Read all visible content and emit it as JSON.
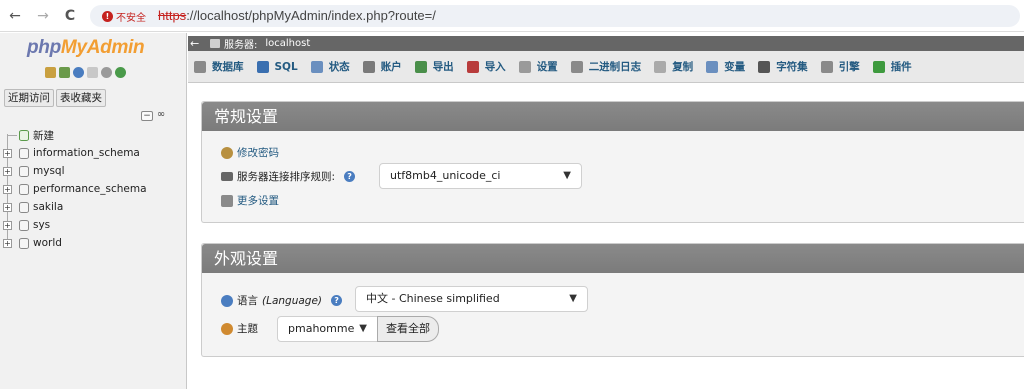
{
  "browser": {
    "back_icon": "←",
    "forward_icon": "→",
    "reload_icon": "C",
    "security_label": "不安全",
    "url_protocol": "https",
    "url_rest": "://localhost/phpMyAdmin/index.php?route=/"
  },
  "nav": {
    "logo_part1": "php",
    "logo_part2": "MyAdmin",
    "tabs": [
      "近期访问",
      "表收藏夹"
    ],
    "new_label": "新建",
    "databases": [
      "information_schema",
      "mysql",
      "performance_schema",
      "sakila",
      "sys",
      "world"
    ]
  },
  "server_bar": {
    "label": "服务器:",
    "server": "localhost"
  },
  "menu": [
    {
      "label": "数据库",
      "icon": "database-icon",
      "color": "#8a8a8a"
    },
    {
      "label": "SQL",
      "icon": "sql-icon",
      "color": "#3a6fb0"
    },
    {
      "label": "状态",
      "icon": "status-icon",
      "color": "#6a8fbf"
    },
    {
      "label": "账户",
      "icon": "accounts-icon",
      "color": "#7a7a7a"
    },
    {
      "label": "导出",
      "icon": "export-icon",
      "color": "#4a8f4a"
    },
    {
      "label": "导入",
      "icon": "import-icon",
      "color": "#b83c3c"
    },
    {
      "label": "设置",
      "icon": "settings-icon",
      "color": "#9a9a9a"
    },
    {
      "label": "二进制日志",
      "icon": "binlog-icon",
      "color": "#8a8a8a"
    },
    {
      "label": "复制",
      "icon": "replication-icon",
      "color": "#aaaaaa"
    },
    {
      "label": "变量",
      "icon": "variables-icon",
      "color": "#6a8fbf"
    },
    {
      "label": "字符集",
      "icon": "charset-icon",
      "color": "#555555"
    },
    {
      "label": "引擎",
      "icon": "engines-icon",
      "color": "#8a8a8a"
    },
    {
      "label": "插件",
      "icon": "plugins-icon",
      "color": "#3e9a3e"
    }
  ],
  "general": {
    "title": "常规设置",
    "change_password": "修改密码",
    "collation_label": "服务器连接排序规则:",
    "collation_value": "utf8mb4_unicode_ci",
    "more_settings": "更多设置"
  },
  "appearance": {
    "title": "外观设置",
    "language_label": "语言",
    "language_label_en": "(Language)",
    "language_value": "中文 - Chinese simplified",
    "theme_label": "主题",
    "theme_value": "pmahomme",
    "view_all": "查看全部"
  },
  "colors": {
    "link": "#235a81",
    "panel_header": "#7b7b7b",
    "server_bar": "#666666",
    "logo_blue": "#6c78af",
    "logo_orange": "#f29e33"
  }
}
